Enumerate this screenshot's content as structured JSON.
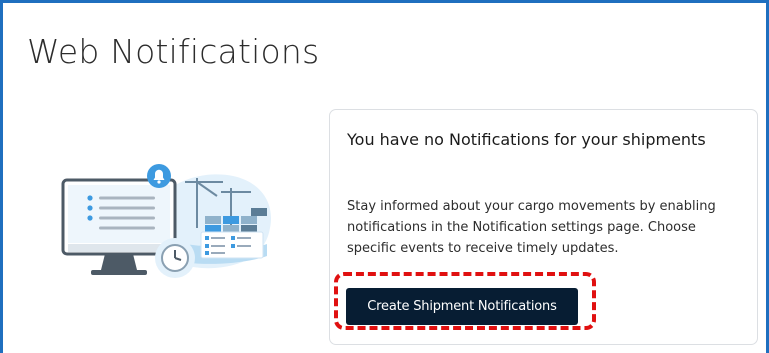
{
  "page": {
    "title": "Web Notifications"
  },
  "empty_state": {
    "heading": "You have no Notifications for your shipments",
    "body": "Stay informed about your cargo movements by enabling notifications in the Notification settings page. Choose specific events to receive timely updates.",
    "cta_label": "Create Shipment Notifications"
  },
  "colors": {
    "frame_border": "#1f6fbf",
    "button_bg": "#071d33",
    "button_text": "#ffffff",
    "highlight": "#e01010",
    "illustration_blue": "#3d9ae0"
  },
  "icons": {
    "illustration": "computer-monitor-port-illustration",
    "bell": "bell-icon",
    "clock": "clock-icon"
  }
}
